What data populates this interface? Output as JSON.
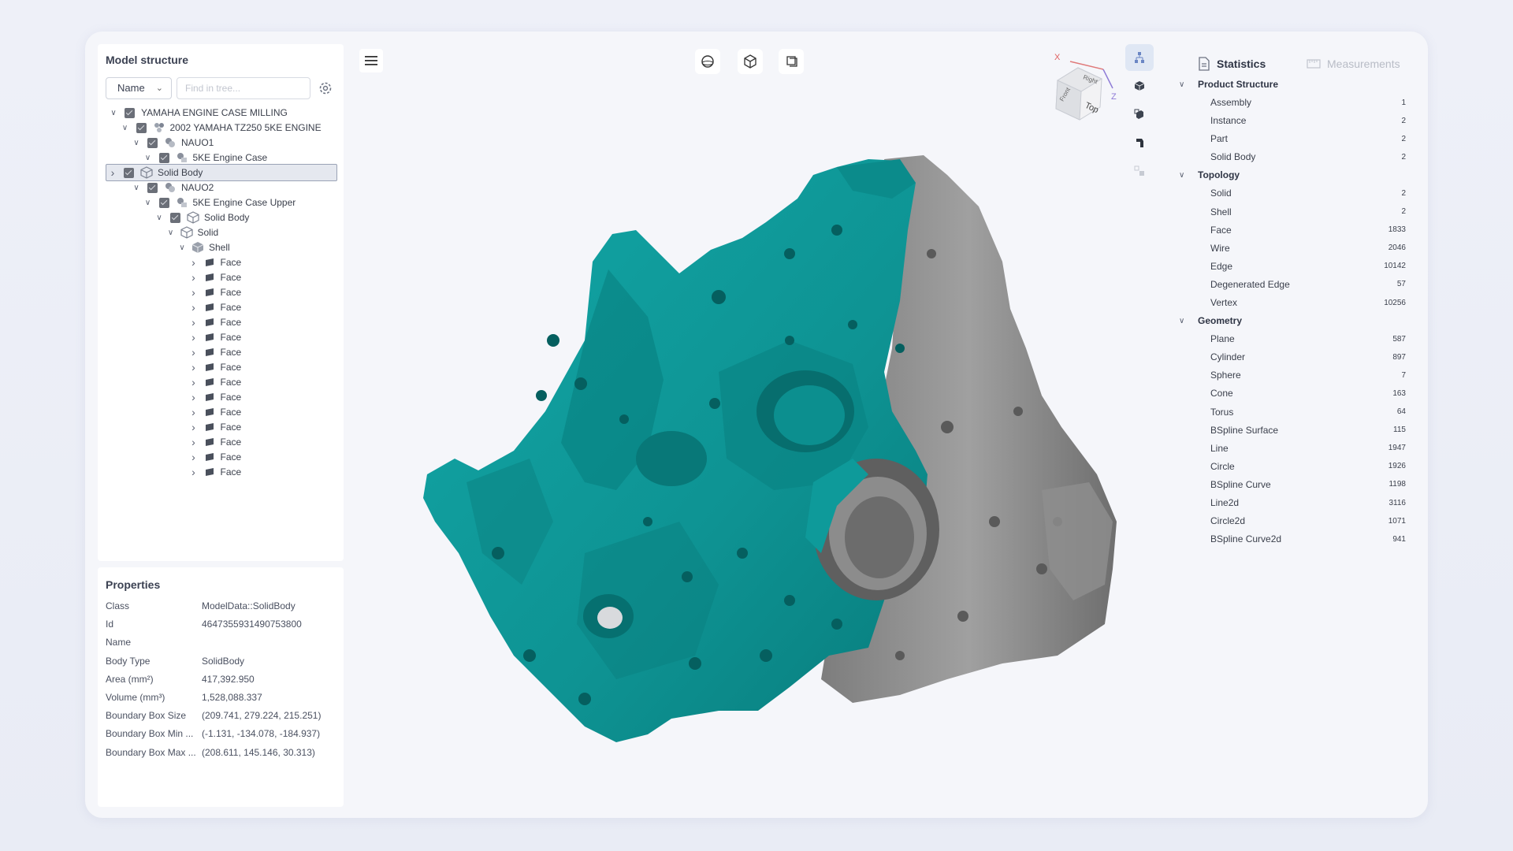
{
  "tree_panel": {
    "title": "Model structure",
    "sort_select": "Name",
    "search_placeholder": "Find in tree...",
    "items": [
      {
        "label": "YAMAHA ENGINE CASE MILLING",
        "depth": 0,
        "expanded": true,
        "checkbox": true,
        "icon": "none"
      },
      {
        "label": "2002 YAMAHA TZ250 5KE ENGINE",
        "depth": 1,
        "expanded": true,
        "checkbox": true,
        "icon": "assembly-icon"
      },
      {
        "label": "NAUO1",
        "depth": 2,
        "expanded": true,
        "checkbox": true,
        "icon": "instance-icon"
      },
      {
        "label": "5KE Engine Case",
        "depth": 3,
        "expanded": true,
        "checkbox": true,
        "icon": "part-icon"
      },
      {
        "label": "Solid Body",
        "depth": 4,
        "expanded": false,
        "checkbox": true,
        "icon": "solid-body-icon",
        "selected": true
      },
      {
        "label": "NAUO2",
        "depth": 2,
        "expanded": true,
        "checkbox": true,
        "icon": "instance-icon"
      },
      {
        "label": "5KE Engine Case Upper",
        "depth": 3,
        "expanded": true,
        "checkbox": true,
        "icon": "part-icon"
      },
      {
        "label": "Solid Body",
        "depth": 4,
        "expanded": true,
        "checkbox": true,
        "icon": "solid-body-icon"
      },
      {
        "label": "Solid",
        "depth": 5,
        "expanded": true,
        "checkbox": false,
        "icon": "solid-icon"
      },
      {
        "label": "Shell",
        "depth": 6,
        "expanded": true,
        "checkbox": false,
        "icon": "shell-icon"
      },
      {
        "label": "Face",
        "depth": 7,
        "expanded": false,
        "checkbox": false,
        "icon": "face-icon"
      },
      {
        "label": "Face",
        "depth": 7,
        "expanded": false,
        "checkbox": false,
        "icon": "face-icon"
      },
      {
        "label": "Face",
        "depth": 7,
        "expanded": false,
        "checkbox": false,
        "icon": "face-icon"
      },
      {
        "label": "Face",
        "depth": 7,
        "expanded": false,
        "checkbox": false,
        "icon": "face-icon"
      },
      {
        "label": "Face",
        "depth": 7,
        "expanded": false,
        "checkbox": false,
        "icon": "face-icon"
      },
      {
        "label": "Face",
        "depth": 7,
        "expanded": false,
        "checkbox": false,
        "icon": "face-icon"
      },
      {
        "label": "Face",
        "depth": 7,
        "expanded": false,
        "checkbox": false,
        "icon": "face-icon"
      },
      {
        "label": "Face",
        "depth": 7,
        "expanded": false,
        "checkbox": false,
        "icon": "face-icon"
      },
      {
        "label": "Face",
        "depth": 7,
        "expanded": false,
        "checkbox": false,
        "icon": "face-icon"
      },
      {
        "label": "Face",
        "depth": 7,
        "expanded": false,
        "checkbox": false,
        "icon": "face-icon"
      },
      {
        "label": "Face",
        "depth": 7,
        "expanded": false,
        "checkbox": false,
        "icon": "face-icon"
      },
      {
        "label": "Face",
        "depth": 7,
        "expanded": false,
        "checkbox": false,
        "icon": "face-icon"
      },
      {
        "label": "Face",
        "depth": 7,
        "expanded": false,
        "checkbox": false,
        "icon": "face-icon"
      },
      {
        "label": "Face",
        "depth": 7,
        "expanded": false,
        "checkbox": false,
        "icon": "face-icon"
      },
      {
        "label": "Face",
        "depth": 7,
        "expanded": false,
        "checkbox": false,
        "icon": "face-icon"
      }
    ]
  },
  "properties": {
    "title": "Properties",
    "rows": [
      {
        "key": "Class",
        "value": "ModelData::SolidBody"
      },
      {
        "key": "Id",
        "value": "4647355931490753800"
      },
      {
        "key": "Name",
        "value": ""
      },
      {
        "key": "Body Type",
        "value": "SolidBody"
      },
      {
        "key": "Area (mm²)",
        "value": "417,392.950"
      },
      {
        "key": "Volume (mm³)",
        "value": "1,528,088.337"
      },
      {
        "key": "Boundary Box Size",
        "value": "(209.741, 279.224, 215.251)"
      },
      {
        "key": "Boundary Box Min ...",
        "value": "(-1.131, -134.078, -184.937)"
      },
      {
        "key": "Boundary Box Max ...",
        "value": "(208.611, 145.146, 30.313)"
      }
    ]
  },
  "toolbar": {
    "menu_icon": "hamburger-icon",
    "view_buttons": [
      "sphere-view-icon",
      "cube-view-icon",
      "section-view-icon"
    ]
  },
  "navcube": {
    "face_top": "Top",
    "face_front": "Front",
    "face_right": "Right",
    "axis_x": "X",
    "axis_z": "Z"
  },
  "right_tools": [
    "tree-toggle-icon",
    "box-tool-icon",
    "section-tool-icon",
    "measure-tool-icon",
    "explode-tool-icon"
  ],
  "stats_panel": {
    "tab_statistics": "Statistics",
    "tab_measurements": "Measurements",
    "groups": [
      {
        "title": "Product Structure",
        "rows": [
          {
            "label": "Assembly",
            "value": "1"
          },
          {
            "label": "Instance",
            "value": "2"
          },
          {
            "label": "Part",
            "value": "2"
          },
          {
            "label": "Solid Body",
            "value": "2"
          }
        ]
      },
      {
        "title": "Topology",
        "rows": [
          {
            "label": "Solid",
            "value": "2"
          },
          {
            "label": "Shell",
            "value": "2"
          },
          {
            "label": "Face",
            "value": "1833"
          },
          {
            "label": "Wire",
            "value": "2046"
          },
          {
            "label": "Edge",
            "value": "10142"
          },
          {
            "label": "Degenerated Edge",
            "value": "57"
          },
          {
            "label": "Vertex",
            "value": "10256"
          }
        ]
      },
      {
        "title": "Geometry",
        "rows": [
          {
            "label": "Plane",
            "value": "587"
          },
          {
            "label": "Cylinder",
            "value": "897"
          },
          {
            "label": "Sphere",
            "value": "7"
          },
          {
            "label": "Cone",
            "value": "163"
          },
          {
            "label": "Torus",
            "value": "64"
          },
          {
            "label": "BSpline Surface",
            "value": "115"
          },
          {
            "label": "Line",
            "value": "1947"
          },
          {
            "label": "Circle",
            "value": "1926"
          },
          {
            "label": "BSpline Curve",
            "value": "1198"
          },
          {
            "label": "Line2d",
            "value": "3116"
          },
          {
            "label": "Circle2d",
            "value": "1071"
          },
          {
            "label": "BSpline Curve2d",
            "value": "941"
          }
        ]
      }
    ]
  },
  "colors": {
    "model_teal": "#0e9a9a",
    "model_gray": "#8a8a8a",
    "accent": "#3d6fb6"
  }
}
